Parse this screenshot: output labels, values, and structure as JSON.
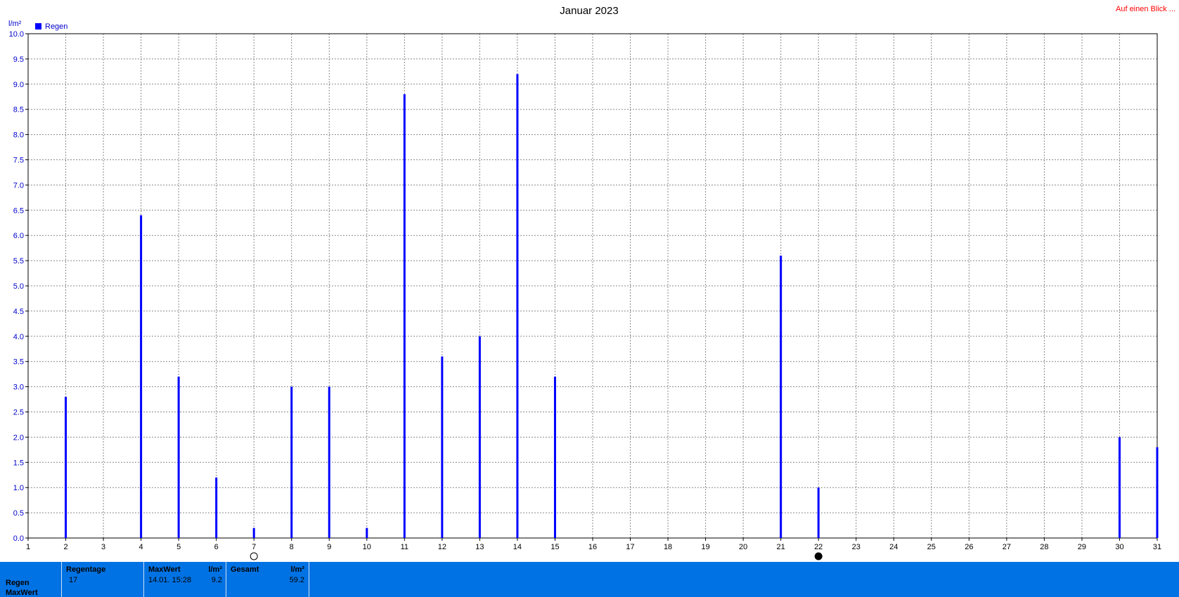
{
  "chart_data": {
    "type": "bar",
    "title": "Januar 2023",
    "ylabel": "l/m²",
    "xlabel": "",
    "ylim": [
      0,
      10
    ],
    "yticks": [
      "0.0",
      "0.5",
      "1.0",
      "1.5",
      "2.0",
      "2.5",
      "3.0",
      "3.5",
      "4.0",
      "4.5",
      "5.0",
      "5.5",
      "6.0",
      "6.5",
      "7.0",
      "7.5",
      "8.0",
      "8.5",
      "9.0",
      "9.5",
      "10.0"
    ],
    "xlim": [
      1,
      31
    ],
    "xticks": [
      "1",
      "2",
      "3",
      "4",
      "5",
      "6",
      "7",
      "8",
      "9",
      "10",
      "11",
      "12",
      "13",
      "14",
      "15",
      "16",
      "17",
      "18",
      "19",
      "20",
      "21",
      "22",
      "23",
      "24",
      "25",
      "26",
      "27",
      "28",
      "29",
      "30",
      "31"
    ],
    "grid": true,
    "legend_position": "top-left",
    "series": [
      {
        "name": "Regen",
        "color": "#0000ff",
        "x": [
          2,
          4,
          5,
          6,
          7,
          8,
          9,
          10,
          11,
          12,
          13,
          14,
          15,
          21,
          22,
          30,
          31
        ],
        "values": [
          2.8,
          6.4,
          3.2,
          1.2,
          0.2,
          3.0,
          3.0,
          0.2,
          8.8,
          3.6,
          4.0,
          9.2,
          3.2,
          5.6,
          1.0,
          2.0,
          1.8
        ]
      }
    ],
    "moon_markers": [
      {
        "day": 7,
        "phase": "full-moon"
      },
      {
        "day": 22,
        "phase": "new-moon"
      }
    ]
  },
  "header": {
    "link_text": "Auf einen Blick ..."
  },
  "footer": {
    "row_labels": [
      "Regen",
      "MaxWert"
    ],
    "regentage_label": "Regentage",
    "regentage_value": "17",
    "maxwert_label": "MaxWert",
    "maxwert_unit": "l/m²",
    "maxwert_date": "14.01.  15:28",
    "maxwert_value": "9.2",
    "gesamt_label": "Gesamt",
    "gesamt_unit": "l/m²",
    "gesamt_value": "59.2",
    "background_color": "#0072e3"
  }
}
